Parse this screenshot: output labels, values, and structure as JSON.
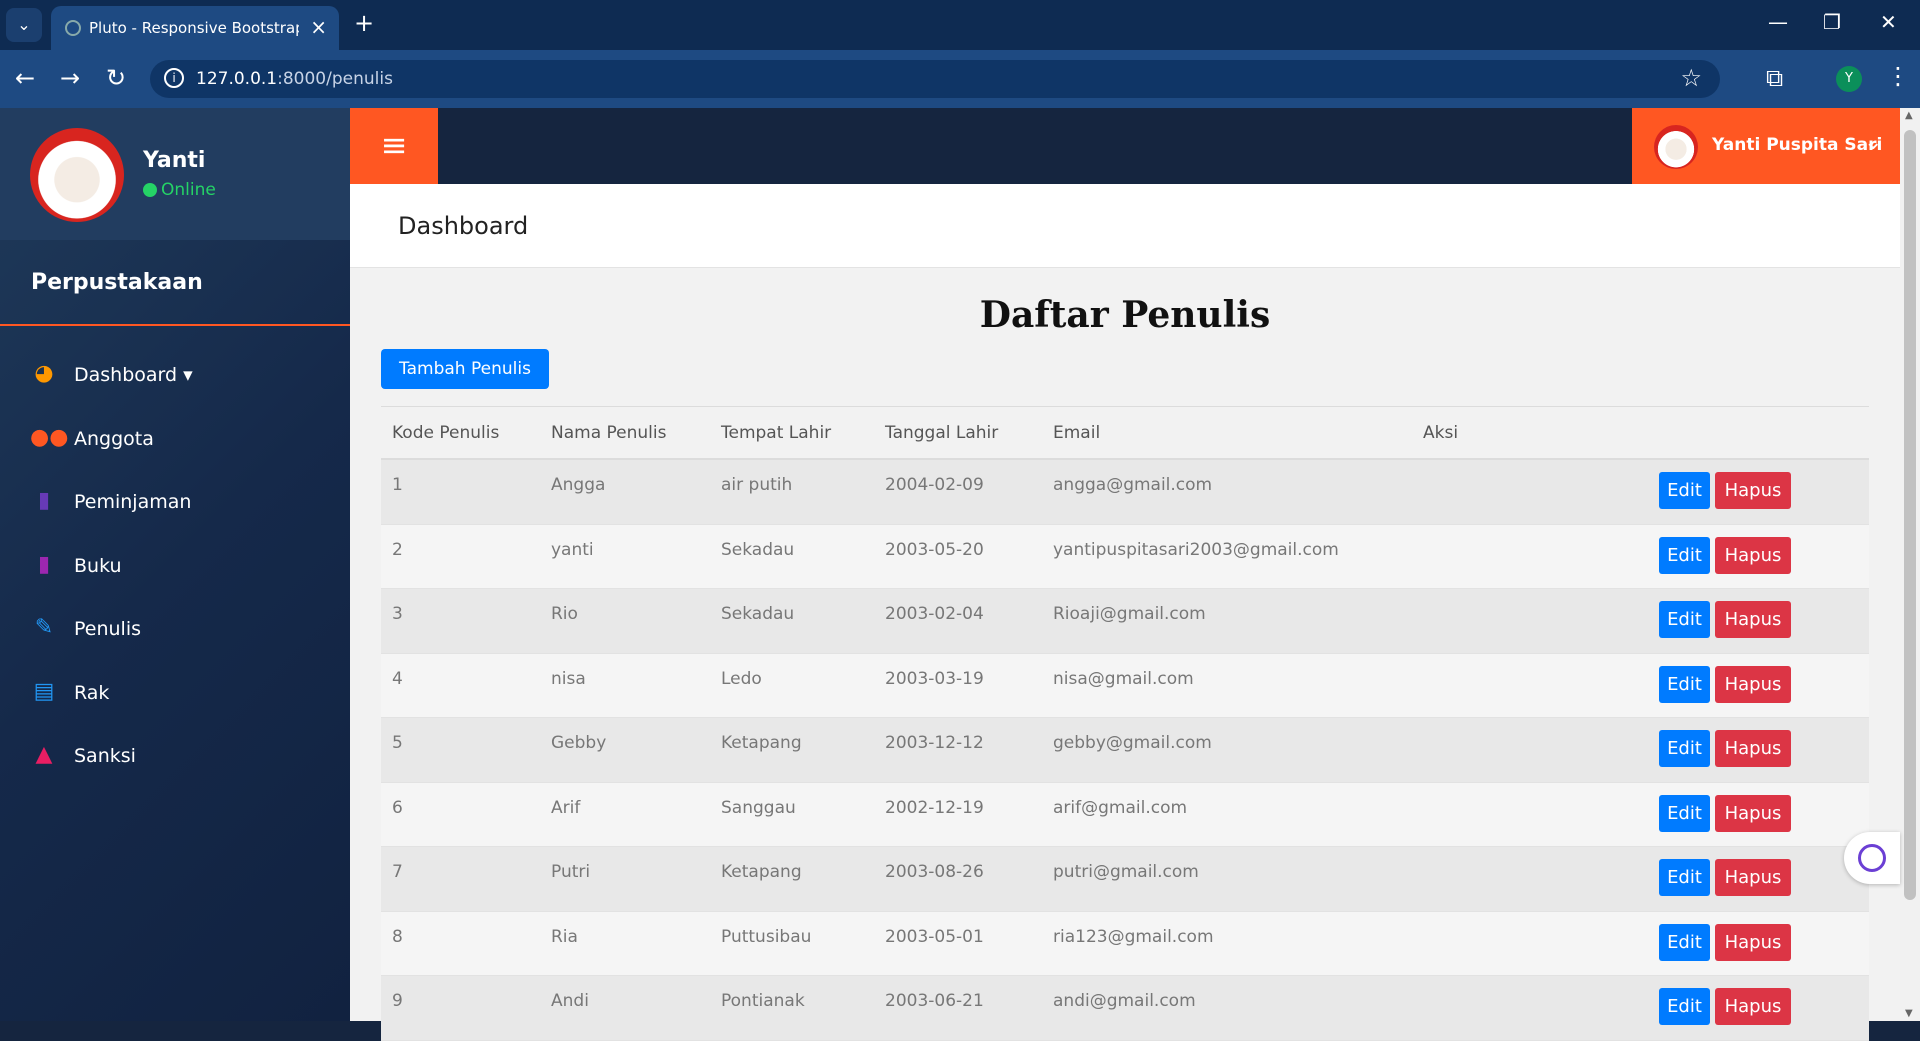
{
  "browser": {
    "tab_title": "Pluto - Responsive Bootstrap Admin",
    "url_host": "127.0.0.1",
    "url_path": ":8000/penulis",
    "profile_initial": "Y"
  },
  "sidebar": {
    "user_name": "Yanti",
    "user_status": "Online",
    "brand": "Perpustakaan",
    "items": [
      {
        "label": "Dashboard ▾",
        "icon": "dashboard-gauge-icon",
        "color": "#ff9800"
      },
      {
        "label": "Anggota",
        "icon": "users-icon",
        "color": "#ff5722"
      },
      {
        "label": "Peminjaman",
        "icon": "book-icon",
        "color": "#673ab7"
      },
      {
        "label": "Buku",
        "icon": "book-icon",
        "color": "#9c27b0"
      },
      {
        "label": "Penulis",
        "icon": "pencil-icon",
        "color": "#2196f3"
      },
      {
        "label": "Rak",
        "icon": "archive-icon",
        "color": "#2196f3"
      },
      {
        "label": "Sanksi",
        "icon": "warning-icon",
        "color": "#e91e63"
      }
    ]
  },
  "topbar": {
    "user_name": "Yanti Puspita Sari"
  },
  "page": {
    "header": "Dashboard",
    "title": "Daftar Penulis",
    "add_button": "Tambah Penulis"
  },
  "table": {
    "columns": [
      "Kode Penulis",
      "Nama Penulis",
      "Tempat Lahir",
      "Tanggal Lahir",
      "Email",
      "Aksi"
    ],
    "edit_label": "Edit",
    "delete_label": "Hapus",
    "rows": [
      {
        "kode": "1",
        "nama": "Angga",
        "tempat": "air putih",
        "tanggal": "2004-02-09",
        "email": "angga@gmail.com"
      },
      {
        "kode": "2",
        "nama": "yanti",
        "tempat": "Sekadau",
        "tanggal": "2003-05-20",
        "email": "yantipuspitasari2003@gmail.com"
      },
      {
        "kode": "3",
        "nama": "Rio",
        "tempat": "Sekadau",
        "tanggal": "2003-02-04",
        "email": "Rioaji@gmail.com"
      },
      {
        "kode": "4",
        "nama": "nisa",
        "tempat": "Ledo",
        "tanggal": "2003-03-19",
        "email": "nisa@gmail.com"
      },
      {
        "kode": "5",
        "nama": "Gebby",
        "tempat": "Ketapang",
        "tanggal": "2003-12-12",
        "email": "gebby@gmail.com"
      },
      {
        "kode": "6",
        "nama": "Arif",
        "tempat": "Sanggau",
        "tanggal": "2002-12-19",
        "email": "arif@gmail.com"
      },
      {
        "kode": "7",
        "nama": "Putri",
        "tempat": "Ketapang",
        "tanggal": "2003-08-26",
        "email": "putri@gmail.com"
      },
      {
        "kode": "8",
        "nama": "Ria",
        "tempat": "Puttusibau",
        "tanggal": "2003-05-01",
        "email": "ria123@gmail.com"
      },
      {
        "kode": "9",
        "nama": "Andi",
        "tempat": "Pontianak",
        "tanggal": "2003-06-21",
        "email": "andi@gmail.com"
      }
    ]
  }
}
